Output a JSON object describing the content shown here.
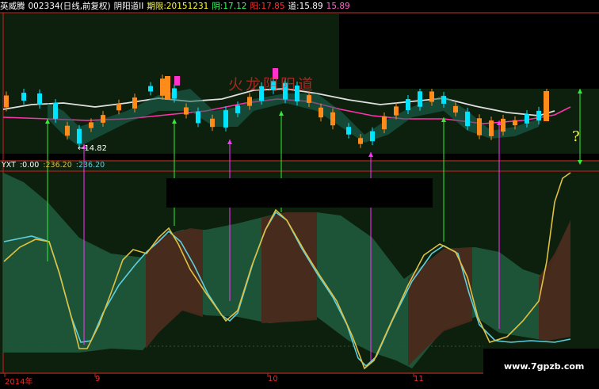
{
  "header": {
    "stock_name": "英威腾",
    "stock_code": "002334",
    "mode": "(日线,前复权)",
    "indicator": "阴阳道II",
    "period_label": "期限:",
    "period_value": "20151231",
    "yin_label": "阴:",
    "yin_value": "17.12",
    "yang_label": "阳:",
    "yang_value": "17.85",
    "dao_label": "道:",
    "dao_value": "15.89",
    "extra_value": "15.89"
  },
  "price_panel": {
    "low_marker": "14.82",
    "question_mark": "?",
    "watermark_text": "火龙阴阳道"
  },
  "sub_panel": {
    "name": "YXT",
    "v1": ":0.00",
    "v2": ":236.20",
    "v3": ":236.20"
  },
  "date_axis": {
    "labels": [
      "2014年",
      "9",
      "10",
      "11"
    ]
  },
  "footer": {
    "site": "www.7gpzb.com"
  },
  "colors": {
    "up": "#ff8c1a",
    "down": "#00e5ff",
    "ma_white": "#e0e0e0",
    "ma_magenta": "#ff33aa",
    "fill_green": "#1f5a3c",
    "fill_brown": "#4a2a1c",
    "line_yellow": "#e0c040",
    "line_cyan": "#5ecfe0",
    "arrow_green": "#33ee33",
    "arrow_magenta": "#ff33ff"
  }
}
